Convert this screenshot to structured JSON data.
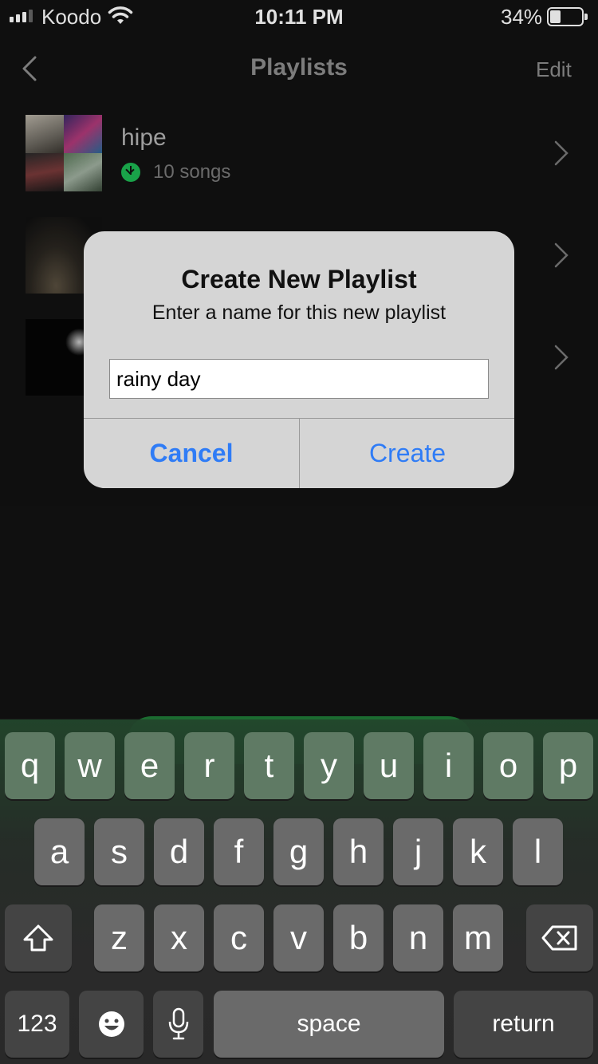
{
  "status_bar": {
    "carrier": "Koodo",
    "time": "10:11 PM",
    "battery_percent": "34%",
    "battery_level": 0.34,
    "signal_bars": 3
  },
  "nav": {
    "title": "Playlists",
    "edit_label": "Edit",
    "back_icon": "chevron-left-icon"
  },
  "playlists": [
    {
      "name": "hipe",
      "song_count": "10 songs",
      "downloaded": true
    },
    {
      "name": "",
      "song_count": ""
    },
    {
      "name": "",
      "song_count": ""
    }
  ],
  "dialog": {
    "title": "Create New Playlist",
    "message": "Enter a name for this new playlist",
    "input_value": "rainy day",
    "cancel_label": "Cancel",
    "create_label": "Create",
    "accent_color": "#2f7cf6"
  },
  "keyboard": {
    "row1": [
      "q",
      "w",
      "e",
      "r",
      "t",
      "y",
      "u",
      "i",
      "o",
      "p"
    ],
    "row2": [
      "a",
      "s",
      "d",
      "f",
      "g",
      "h",
      "j",
      "k",
      "l"
    ],
    "row3": [
      "z",
      "x",
      "c",
      "v",
      "b",
      "n",
      "m"
    ],
    "numbers_label": "123",
    "space_label": "space",
    "return_label": "return",
    "shift_icon": "shift-icon",
    "delete_icon": "delete-icon",
    "emoji_icon": "emoji-icon",
    "mic_icon": "microphone-icon"
  },
  "colors": {
    "background": "#121212",
    "spotify_green": "#1db954",
    "dialog_bg": "#d5d5d5"
  }
}
